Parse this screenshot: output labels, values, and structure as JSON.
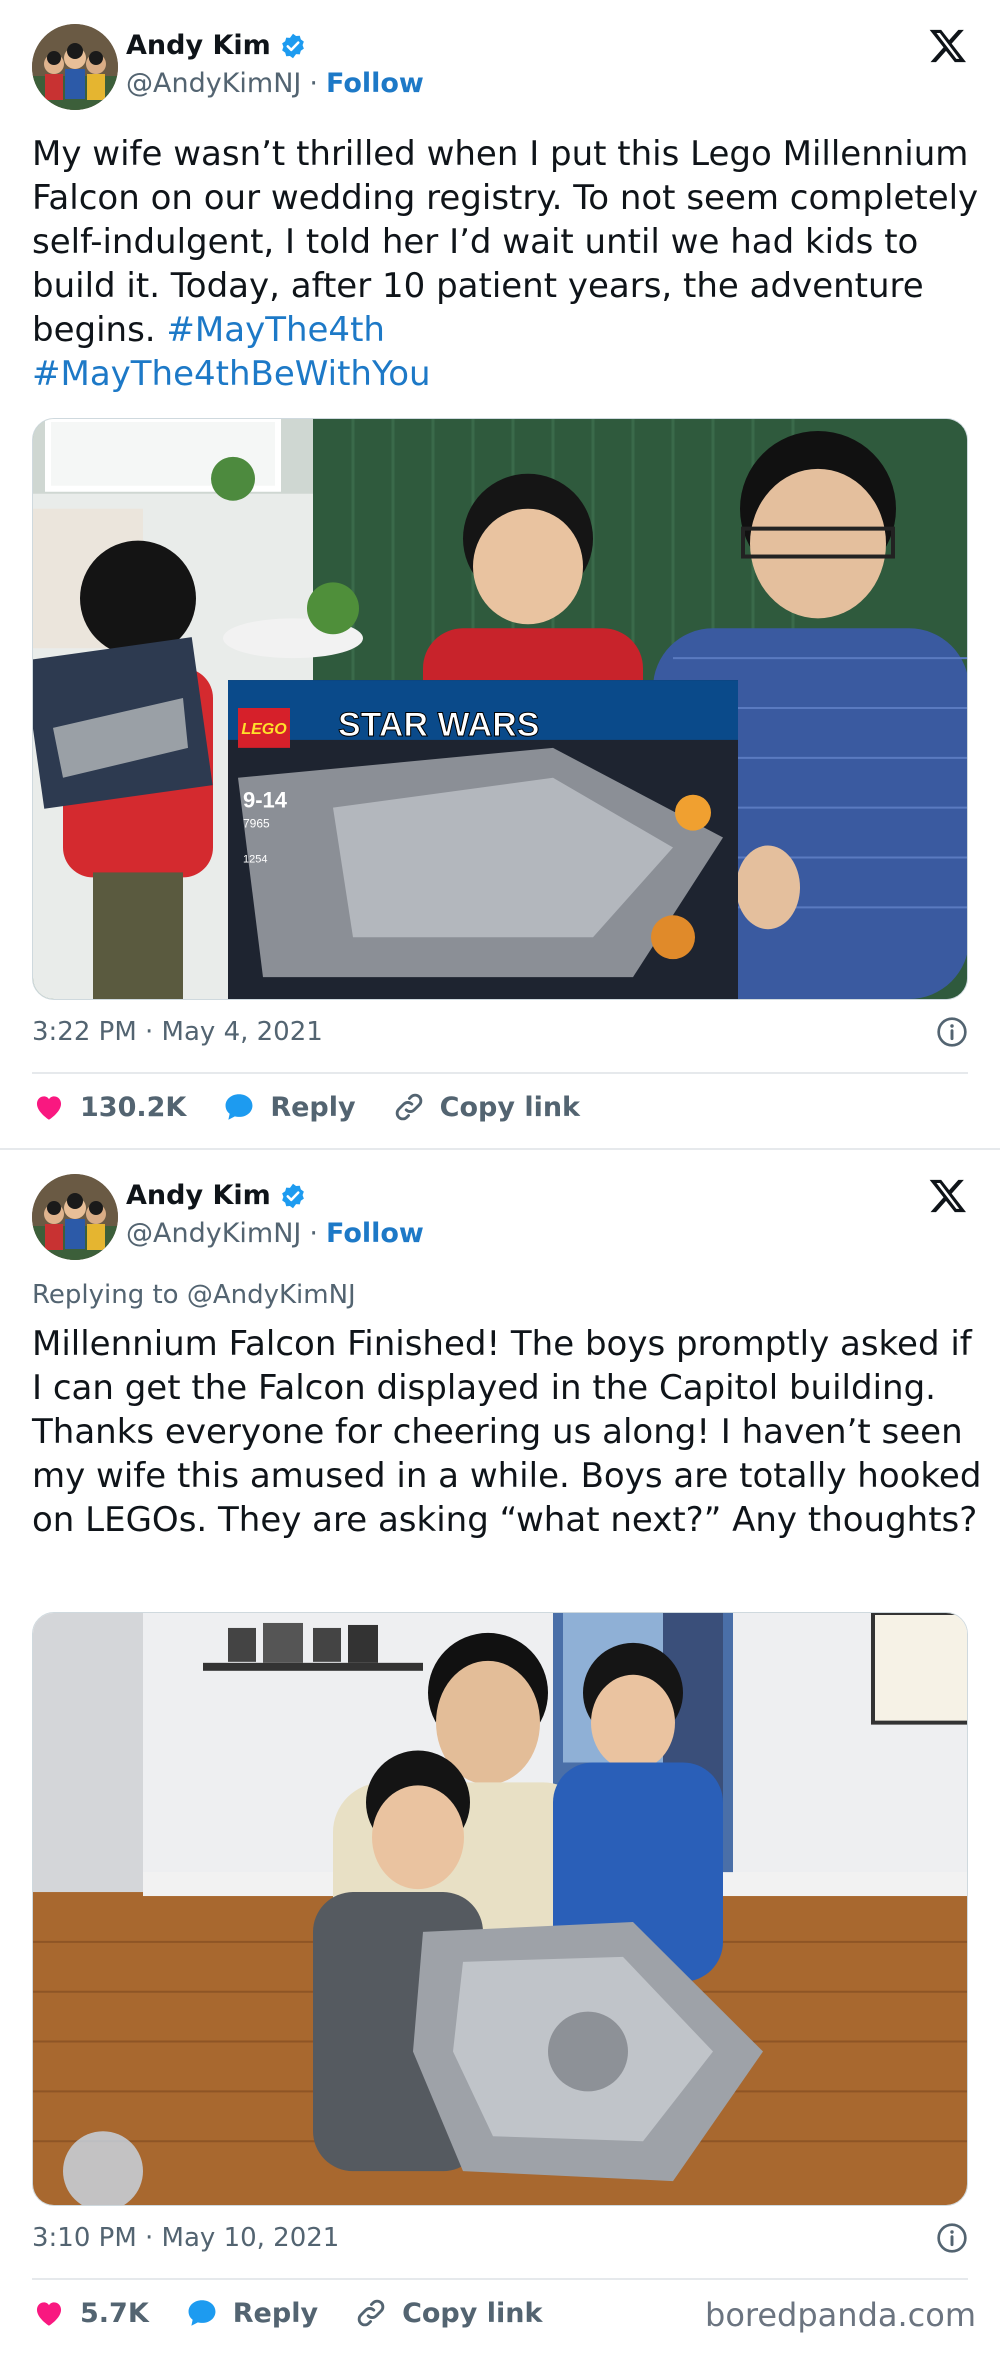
{
  "tweets": [
    {
      "author": {
        "name": "Andy Kim",
        "handle": "@AndyKimNJ",
        "separator": "·",
        "follow_label": "Follow"
      },
      "replying_to": "",
      "text": "My wife wasn’t thrilled when I put this Lego Millennium Falcon on our wedding registry. To not seem completely self-indulgent, I told her I’d wait until we had kids to build it. Today, after 10 patient years, the adventure begins.",
      "hashtags": [
        "#MayThe4th",
        "#MayThe4thBeWithYou"
      ],
      "timestamp": "3:22 PM · May 4, 2021",
      "likes": "130.2K",
      "reply_label": "Reply",
      "copy_label": "Copy link",
      "photo": {
        "box_brand": "LEGO",
        "box_title": "STAR WARS",
        "box_age": "9-14",
        "box_number": "7965",
        "box_pieces": "1254"
      }
    },
    {
      "author": {
        "name": "Andy Kim",
        "handle": "@AndyKimNJ",
        "separator": "·",
        "follow_label": "Follow"
      },
      "replying_to": "Replying to @AndyKimNJ",
      "text": "Millennium Falcon Finished! The boys promptly asked if I can get the Falcon displayed in the Capitol building. Thanks everyone for cheering us along! I haven’t seen my wife this amused in a while. Boys are totally hooked on LEGOs. They are asking “what next?” Any thoughts?",
      "hashtags": [],
      "timestamp": "3:10 PM · May 10, 2021",
      "likes": "5.7K",
      "reply_label": "Reply",
      "copy_label": "Copy link"
    }
  ],
  "icons": {
    "verified": "verified-badge-icon",
    "x": "x-logo-icon",
    "info": "info-icon",
    "like": "heart-icon",
    "reply": "reply-bubble-icon",
    "link": "link-icon"
  },
  "colors": {
    "accent": "#1d79c7",
    "like": "#f91880",
    "muted": "#536471"
  },
  "watermark": "boredpanda.com"
}
